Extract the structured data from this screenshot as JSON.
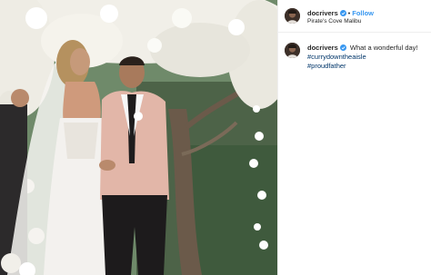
{
  "header": {
    "username": "docrivers",
    "separator": "•",
    "follow_label": "Follow",
    "location": "Pirate's Cove Malibu"
  },
  "comment": {
    "username": "docrivers",
    "caption": "What a wonderful day!",
    "hashtags": [
      "#currydowntheaisle",
      "#proudfather"
    ]
  },
  "icons": {
    "verified": "verified-badge-icon",
    "avatar": "profile-avatar"
  },
  "colors": {
    "link": "#3897f0",
    "hashtag": "#003569",
    "verified": "#3897f0",
    "text": "#262626",
    "jacket": "#e2b6a8"
  }
}
